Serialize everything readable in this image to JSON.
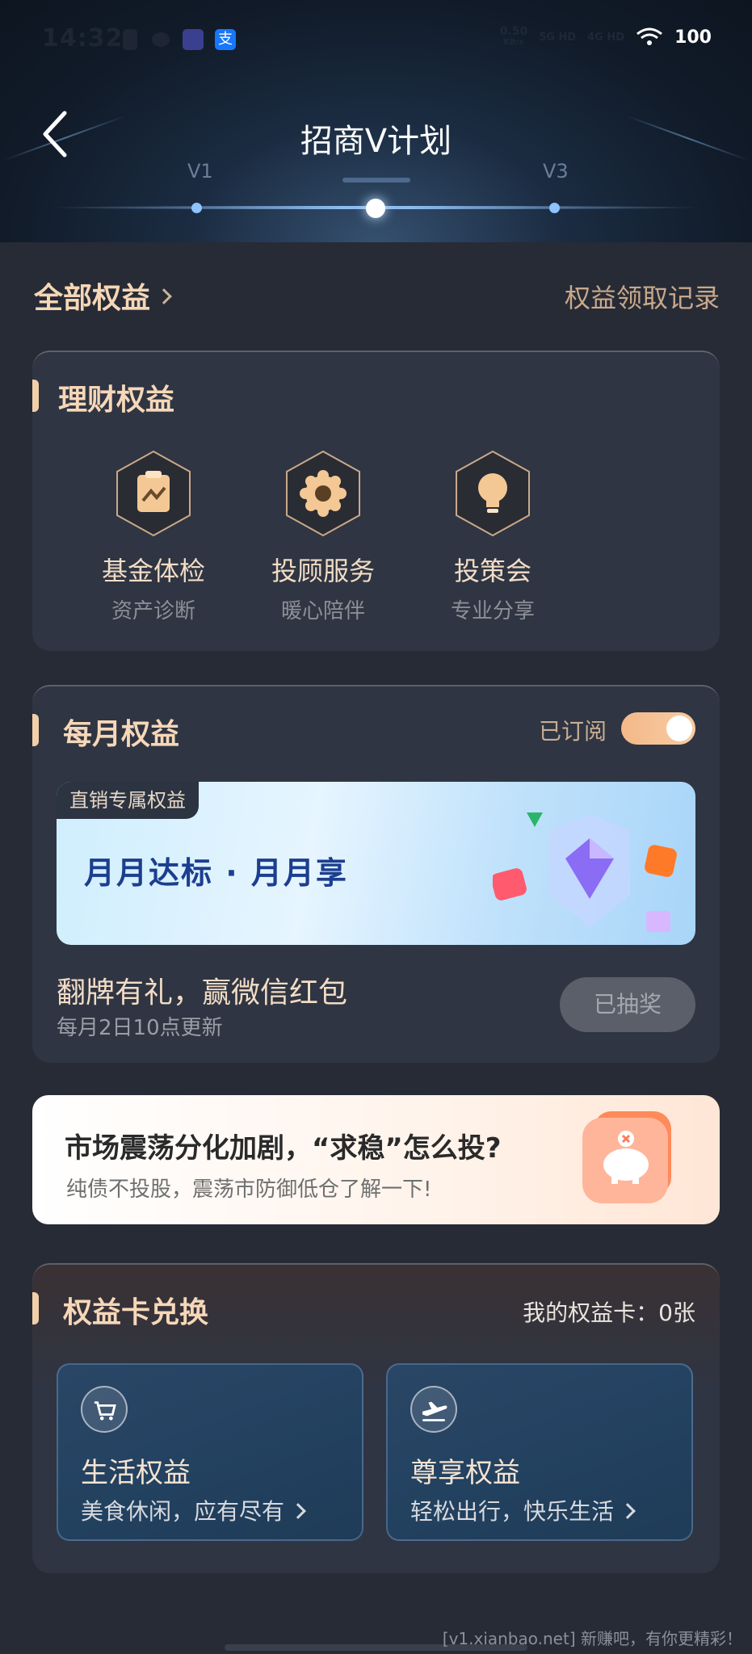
{
  "status_bar": {
    "time": "14:32",
    "net_speed_value": "0.50",
    "net_speed_unit": "KB/s",
    "signal_1": "5G HD",
    "signal_2": "4G HD",
    "battery": "100"
  },
  "header": {
    "title": "招商V计划",
    "level_left": "V1",
    "level_right": "V3"
  },
  "rights_header": {
    "all_rights": "全部权益",
    "records": "权益领取记录"
  },
  "wealth": {
    "title": "理财权益",
    "items": [
      {
        "name": "基金体检",
        "sub": "资产诊断",
        "icon": "clipboard-chart-icon"
      },
      {
        "name": "投顾服务",
        "sub": "暖心陪伴",
        "icon": "gear-flower-icon"
      },
      {
        "name": "投策会",
        "sub": "专业分享",
        "icon": "lightbulb-icon"
      }
    ]
  },
  "monthly": {
    "title": "每月权益",
    "subscribed_label": "已订阅",
    "subscribed": true,
    "banner_tag": "直销专属权益",
    "banner_text": "月月达标 · 月月享",
    "promo_title": "翻牌有礼，赢微信红包",
    "promo_sub": "每月2日10点更新",
    "draw_button": "已抽奖"
  },
  "ad": {
    "title": "市场震荡分化加剧，“求稳”怎么投?",
    "sub": "纯债不投股，震荡市防御低仓了解一下!"
  },
  "exchange": {
    "title": "权益卡兑换",
    "my_cards": "我的权益卡：0张",
    "cards": [
      {
        "title": "生活权益",
        "sub": "美食休闲，应有尽有",
        "icon": "cart-icon"
      },
      {
        "title": "尊享权益",
        "sub": "轻松出行，快乐生活",
        "icon": "airplane-icon"
      }
    ]
  },
  "watermark": "[v1.xianbao.net] 新赚吧，有你更精彩！",
  "colors": {
    "background": "#262b36",
    "card": "#2f3542",
    "gold_text": "#f6d7b8",
    "toggle": "#f4b989",
    "banner_text": "#1b3e8f"
  }
}
